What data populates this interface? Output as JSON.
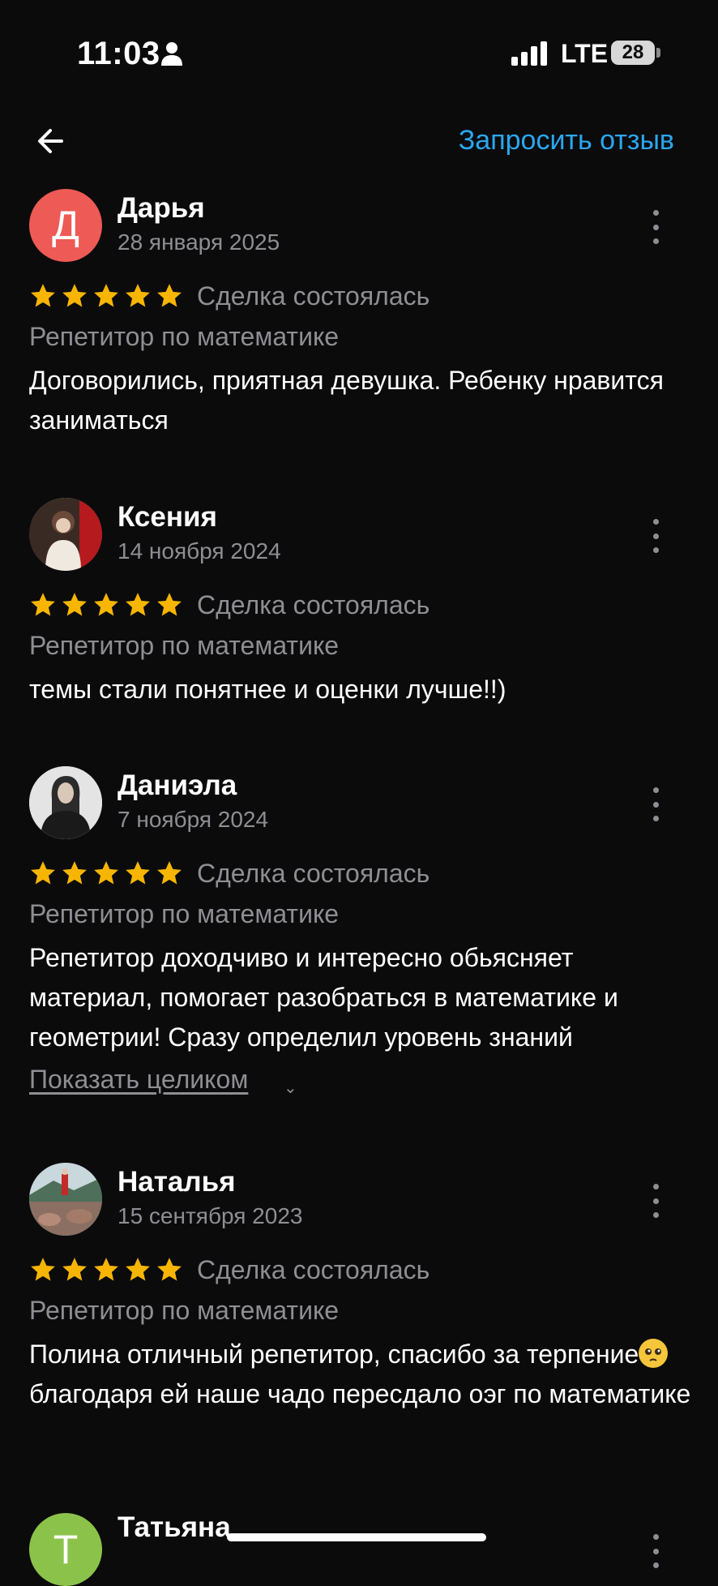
{
  "status": {
    "time": "11:03",
    "network": "LTE",
    "battery": "28"
  },
  "nav": {
    "request_label": "Запросить отзыв"
  },
  "reviews": [
    {
      "name": "Дарья",
      "date": "28 января 2025",
      "avatar_letter": "Д",
      "avatar_color": "#ee5a55",
      "deal": "Сделка состоялась",
      "category": "Репетитор по математике",
      "text": "Договорились, приятная девушка. Ребенку нравится заниматься"
    },
    {
      "name": "Ксения",
      "date": "14 ноября 2024",
      "deal": "Сделка состоялась",
      "category": "Репетитор по математике",
      "text": "темы стали понятнее и оценки лучше!!)"
    },
    {
      "name": "Даниэла",
      "date": "7 ноября 2024",
      "deal": "Сделка состоялась",
      "category": "Репетитор по математике",
      "text": "Репетитор доходчиво и интересно обьясняет материал, помогает разобраться в математике и геометрии!  Сразу определил уровень знаний",
      "show_more": "Показать целиком"
    },
    {
      "name": "Наталья",
      "date": "15 сентября 2023",
      "deal": "Сделка состоялась",
      "category": "Репетитор по математике",
      "text_before": "Полина отличный репетитор, спасибо за терпение",
      "text_after": "благодаря ей наше чадо пересдало оэг по математике"
    },
    {
      "name": "Татьяна",
      "avatar_letter": "Т",
      "avatar_color": "#8bc34a"
    }
  ],
  "colors": {
    "accent": "#2aa7f0",
    "star": "#f7b500",
    "muted": "#8e8e93"
  },
  "icons": [
    "person-icon",
    "signal-icon",
    "back-arrow-icon",
    "more-vertical-icon",
    "star-icon",
    "chevron-down-icon",
    "emoji-icon"
  ]
}
